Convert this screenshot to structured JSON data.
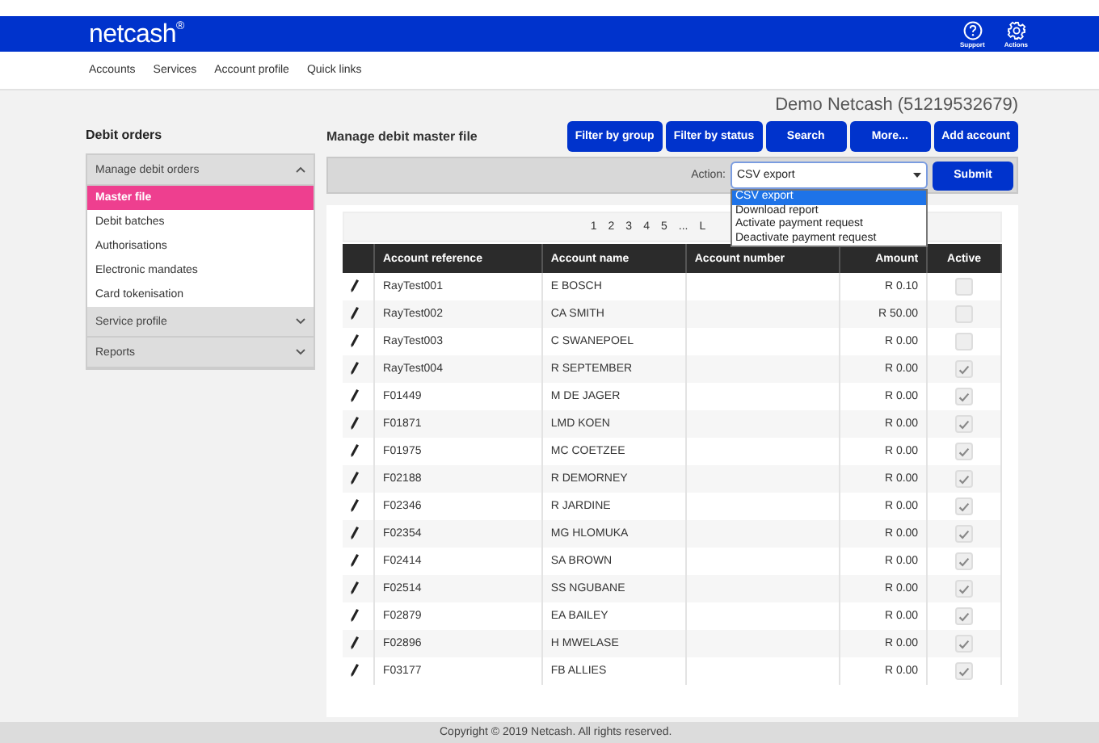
{
  "header": {
    "logo": "netcash",
    "logo_mark": "®",
    "icons": [
      {
        "kind": "help",
        "label": "Support"
      },
      {
        "kind": "gear",
        "label": "Actions"
      }
    ]
  },
  "nav": [
    "Accounts",
    "Services",
    "Account profile",
    "Quick links"
  ],
  "account_title": "Demo Netcash (51219532679)",
  "sidebar": {
    "title": "Debit orders",
    "groups": [
      {
        "label": "Manage debit orders",
        "expanded": true,
        "items": [
          {
            "label": "Master file",
            "selected": true
          },
          {
            "label": "Debit batches",
            "selected": false
          },
          {
            "label": "Authorisations",
            "selected": false
          },
          {
            "label": "Electronic mandates",
            "selected": false
          },
          {
            "label": "Card tokenisation",
            "selected": false
          }
        ]
      },
      {
        "label": "Service profile",
        "expanded": false
      },
      {
        "label": "Reports",
        "expanded": false
      }
    ]
  },
  "main": {
    "title": "Manage debit master file",
    "buttons": [
      "Filter by group",
      "Filter by status",
      "Search",
      "More...",
      "Add account"
    ],
    "action_label": "Action:",
    "action_value": "CSV export",
    "submit": "Submit",
    "dropdown": [
      {
        "label": "CSV export",
        "selected": true
      },
      {
        "label": "Download report",
        "selected": false
      },
      {
        "label": "Activate payment request",
        "selected": false
      },
      {
        "label": "Deactivate payment request",
        "selected": false
      }
    ],
    "pagination": [
      "1",
      "2",
      "3",
      "4",
      "5",
      "...",
      "L"
    ],
    "table": {
      "columns": [
        "Account reference",
        "Account name",
        "Account number",
        "Amount",
        "Active"
      ],
      "rows": [
        {
          "reference": "RayTest001",
          "name": "E BOSCH",
          "amount": "R 0.10",
          "active": false
        },
        {
          "reference": "RayTest002",
          "name": "CA SMITH",
          "amount": "R 50.00",
          "active": false
        },
        {
          "reference": "RayTest003",
          "name": "C SWANEPOEL",
          "amount": "R 0.00",
          "active": false
        },
        {
          "reference": "RayTest004",
          "name": "R SEPTEMBER",
          "amount": "R 0.00",
          "active": true
        },
        {
          "reference": "F01449",
          "name": "M DE JAGER",
          "amount": "R 0.00",
          "active": true
        },
        {
          "reference": "F01871",
          "name": "LMD KOEN",
          "amount": "R 0.00",
          "active": true
        },
        {
          "reference": "F01975",
          "name": "MC COETZEE",
          "amount": "R 0.00",
          "active": true
        },
        {
          "reference": "F02188",
          "name": "R DEMORNEY",
          "amount": "R 0.00",
          "active": true
        },
        {
          "reference": "F02346",
          "name": "R JARDINE",
          "amount": "R 0.00",
          "active": true
        },
        {
          "reference": "F02354",
          "name": "MG HLOMUKA",
          "amount": "R 0.00",
          "active": true
        },
        {
          "reference": "F02414",
          "name": "SA BROWN",
          "amount": "R 0.00",
          "active": true
        },
        {
          "reference": "F02514",
          "name": "SS NGUBANE",
          "amount": "R 0.00",
          "active": true
        },
        {
          "reference": "F02879",
          "name": "EA BAILEY",
          "amount": "R 0.00",
          "active": true
        },
        {
          "reference": "F02896",
          "name": "H MWELASE",
          "amount": "R 0.00",
          "active": true
        },
        {
          "reference": "F03177",
          "name": "FB ALLIES",
          "amount": "R 0.00",
          "active": true
        }
      ]
    }
  },
  "footer": "Copyright © 2019 Netcash. All rights reserved."
}
